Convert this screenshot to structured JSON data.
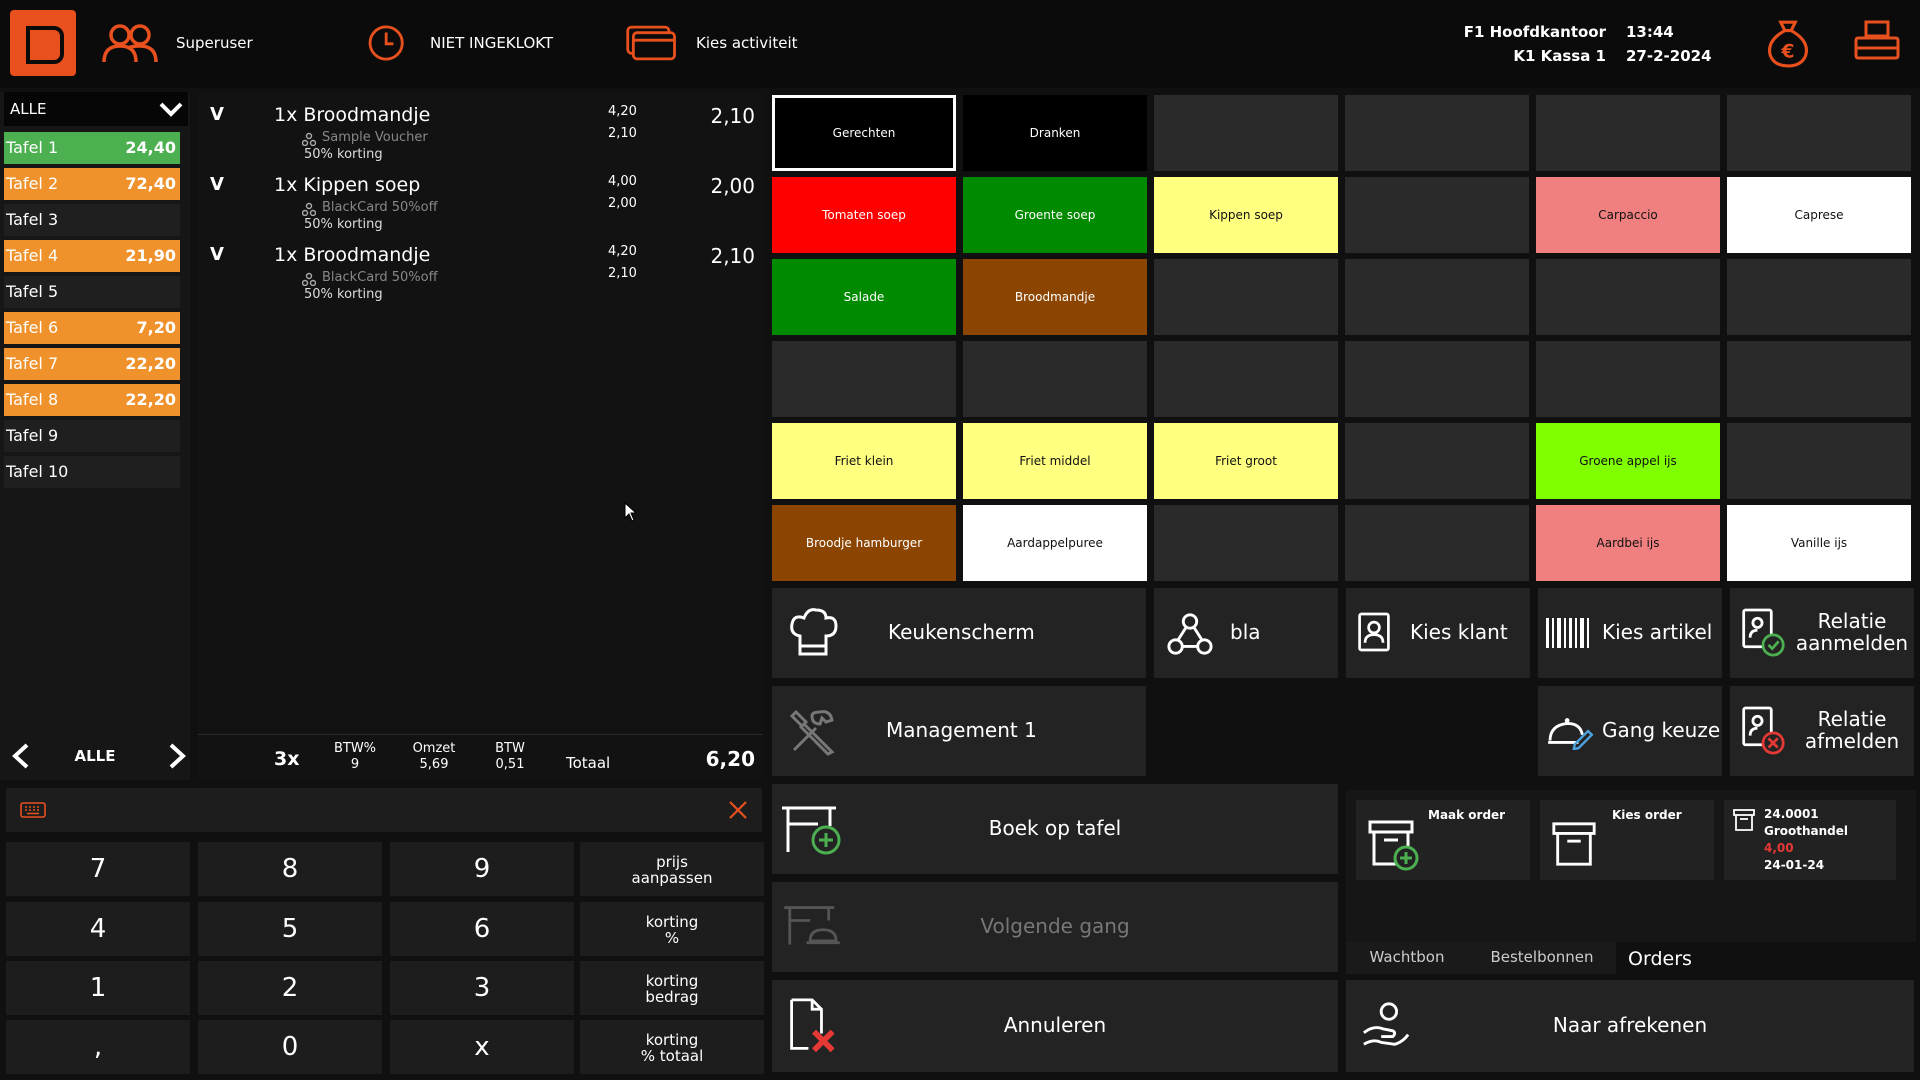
{
  "topbar": {
    "user": "Superuser",
    "clock_status": "NIET INGEKLOKT",
    "activity": "Kies activiteit",
    "branch": "F1 Hoofdkantoor",
    "register": "K1 Kassa 1",
    "time": "13:44",
    "date": "27-2-2024",
    "accent": "#e8501e"
  },
  "tables": {
    "filter": "ALLE",
    "nav_label": "ALLE",
    "items": [
      {
        "name": "Tafel 1",
        "amount": "24,40",
        "state": "green"
      },
      {
        "name": "Tafel 2",
        "amount": "72,40",
        "state": "orange"
      },
      {
        "name": "Tafel 3",
        "amount": "",
        "state": "none"
      },
      {
        "name": "Tafel 4",
        "amount": "21,90",
        "state": "orange"
      },
      {
        "name": "Tafel 5",
        "amount": "",
        "state": "none"
      },
      {
        "name": "Tafel 6",
        "amount": "7,20",
        "state": "orange"
      },
      {
        "name": "Tafel 7",
        "amount": "22,20",
        "state": "orange"
      },
      {
        "name": "Tafel 8",
        "amount": "22,20",
        "state": "orange"
      },
      {
        "name": "Tafel 9",
        "amount": "",
        "state": "none"
      },
      {
        "name": "Tafel 10",
        "amount": "",
        "state": "none"
      }
    ]
  },
  "order": {
    "lines": [
      {
        "flag": "V",
        "name": "1x Broodmandje",
        "voucher": "Sample Voucher",
        "discount": "50% korting",
        "price": "4,20",
        "discounted": "2,10",
        "total": "2,10"
      },
      {
        "flag": "V",
        "name": "1x Kippen soep",
        "voucher": "BlackCard 50%off",
        "discount": "50% korting",
        "price": "4,00",
        "discounted": "2,00",
        "total": "2,00"
      },
      {
        "flag": "V",
        "name": "1x Broodmandje",
        "voucher": "BlackCard 50%off",
        "discount": "50% korting",
        "price": "4,20",
        "discounted": "2,10",
        "total": "2,10"
      }
    ],
    "totals": {
      "count": "3x",
      "btw_pct_label": "BTW%",
      "btw_pct": "9",
      "omzet_label": "Omzet",
      "omzet": "5,69",
      "btw_label": "BTW",
      "btw": "0,51",
      "total_label": "Totaal",
      "total": "6,20"
    }
  },
  "numpad": {
    "keys": [
      "7",
      "8",
      "9",
      "4",
      "5",
      "6",
      "1",
      "2",
      "3",
      ",",
      "0",
      "x"
    ],
    "side": [
      {
        "l1": "prijs",
        "l2": "aanpassen"
      },
      {
        "l1": "korting",
        "l2": "%"
      },
      {
        "l1": "korting",
        "l2": "bedrag"
      },
      {
        "l1": "korting",
        "l2": "% totaal"
      }
    ]
  },
  "products": [
    {
      "label": "Gerechten",
      "color": "#000000",
      "style": "sel"
    },
    {
      "label": "Dranken",
      "color": "#000000",
      "style": "dark"
    },
    {
      "label": "",
      "color": "#2a2a2a",
      "style": "dark"
    },
    {
      "label": "",
      "color": "#2a2a2a",
      "style": "dark"
    },
    {
      "label": "",
      "color": "#2a2a2a",
      "style": "dark"
    },
    {
      "label": "",
      "color": "#2a2a2a",
      "style": "dark"
    },
    {
      "label": "Tomaten soep",
      "color": "#ff0000",
      "style": "dark"
    },
    {
      "label": "Groente soep",
      "color": "#008a00",
      "style": "dark"
    },
    {
      "label": "Kippen soep",
      "color": "#ffff80",
      "style": "lt"
    },
    {
      "label": "",
      "color": "#2a2a2a",
      "style": "dark"
    },
    {
      "label": "Carpaccio",
      "color": "#f08080",
      "style": "lt"
    },
    {
      "label": "Caprese",
      "color": "#ffffff",
      "style": "lt"
    },
    {
      "label": "Salade",
      "color": "#008a00",
      "style": "dark"
    },
    {
      "label": "Broodmandje",
      "color": "#8b4500",
      "style": "dark"
    },
    {
      "label": "",
      "color": "#2a2a2a",
      "style": "dark"
    },
    {
      "label": "",
      "color": "#2a2a2a",
      "style": "dark"
    },
    {
      "label": "",
      "color": "#2a2a2a",
      "style": "dark"
    },
    {
      "label": "",
      "color": "#2a2a2a",
      "style": "dark"
    },
    {
      "label": "",
      "color": "#2a2a2a",
      "style": "dark"
    },
    {
      "label": "",
      "color": "#2a2a2a",
      "style": "dark"
    },
    {
      "label": "",
      "color": "#2a2a2a",
      "style": "dark"
    },
    {
      "label": "",
      "color": "#2a2a2a",
      "style": "dark"
    },
    {
      "label": "",
      "color": "#2a2a2a",
      "style": "dark"
    },
    {
      "label": "",
      "color": "#2a2a2a",
      "style": "dark"
    },
    {
      "label": "Friet klein",
      "color": "#ffff80",
      "style": "lt"
    },
    {
      "label": "Friet middel",
      "color": "#ffff80",
      "style": "lt"
    },
    {
      "label": "Friet groot",
      "color": "#ffff80",
      "style": "lt"
    },
    {
      "label": "",
      "color": "#2a2a2a",
      "style": "dark"
    },
    {
      "label": "Groene appel ijs",
      "color": "#80ff00",
      "style": "lt"
    },
    {
      "label": "",
      "color": "#2a2a2a",
      "style": "dark"
    },
    {
      "label": "Broodje hamburger",
      "color": "#8b4500",
      "style": "dark"
    },
    {
      "label": "Aardappelpuree",
      "color": "#ffffff",
      "style": "lt"
    },
    {
      "label": "",
      "color": "#2a2a2a",
      "style": "dark"
    },
    {
      "label": "",
      "color": "#2a2a2a",
      "style": "dark"
    },
    {
      "label": "Aardbei ijs",
      "color": "#f08080",
      "style": "lt"
    },
    {
      "label": "Vanille ijs",
      "color": "#ffffff",
      "style": "lt"
    }
  ],
  "actions": {
    "kitchen": "Keukenscherm",
    "bla": "bla",
    "choose_customer": "Kies klant",
    "choose_article": "Kies artikel",
    "relation_login": "Relatie aanmelden",
    "management": "Management 1",
    "course_choice": "Gang keuze",
    "relation_logout": "Relatie afmelden",
    "book_on_table": "Boek op tafel",
    "next_course": "Volgende gang",
    "cancel": "Annuleren",
    "checkout": "Naar afrekenen"
  },
  "orders_panel": {
    "make_order": "Maak order",
    "choose_order": "Kies order",
    "order_number": "24.0001",
    "supplier": "Groothandel",
    "order_amount": "4,00",
    "order_date": "24-01-24",
    "tabs": [
      "Wachtbon",
      "Bestelbonnen",
      "Orders"
    ],
    "active_tab": "Orders"
  }
}
